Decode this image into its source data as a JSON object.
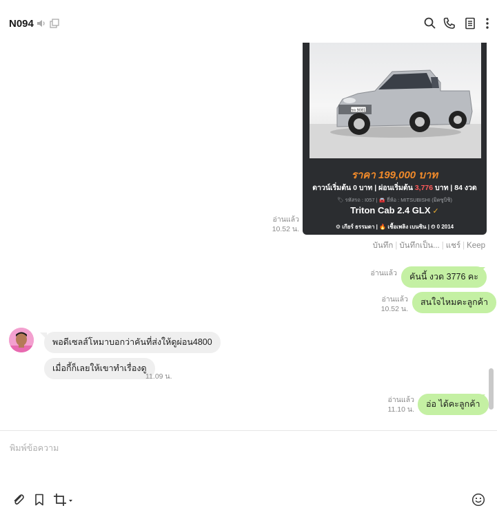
{
  "header": {
    "title": "N094",
    "icons": [
      "speaker-icon",
      "open-window-icon",
      "search-icon",
      "phone-icon",
      "note-icon",
      "more-icon"
    ]
  },
  "photo_card": {
    "price": "ราคา 199,000 บาท",
    "terms_prefix": "ดาวน์เริ่มต้น 0 บาท | ผ่อนเริ่มต้น ",
    "terms_installment": "3,776",
    "terms_suffix": " บาท | 84 งวด",
    "code_info": "🏷 รหัสรถ : I057 | 🚘 ยี่ห้อ : MITSUBISHI (มิตซูบิชิ)",
    "model": "Triton Cab 2.4 GLX",
    "specs": "⚙ เกียร์ ธรรมดา   |   🔥 เชื้อเพลิง เบนซิน   |   ⏲ 0 2014",
    "plate": "ขจ 9081"
  },
  "photo_meta": {
    "read": "อ่านแล้ว",
    "time": "10.52 น."
  },
  "photo_actions": [
    "บันทึก",
    "บันทึกเป็น...",
    "แชร์",
    "Keep"
  ],
  "messages": [
    {
      "side": "mine",
      "text": "คันนี้ งวด 3776 คะ",
      "read": "อ่านแล้ว",
      "time": ""
    },
    {
      "side": "mine",
      "text": "สนใจไหมคะลูกค้า",
      "read": "อ่านแล้ว",
      "time": "10.52 น."
    },
    {
      "side": "theirs",
      "text": "พอดีเซลส์โหมาบอกว่าคันที่ส่งให้ดูผ่อน4800",
      "time": ""
    },
    {
      "side": "theirs",
      "text": "เมื่อกี้ก็เลยให้เขาทำเรื่องดู",
      "time": "11.09 น."
    },
    {
      "side": "mine",
      "text": "อ่อ ได้คะลูกค้า",
      "read": "อ่านแล้ว",
      "time": "11.10 น."
    }
  ],
  "input": {
    "placeholder": "พิมพ์ข้อความ",
    "value": ""
  },
  "colors": {
    "my_bubble": "#c4f0a3",
    "their_bubble": "#efefef",
    "price": "#f08a2a",
    "installment": "#ff5a5a"
  }
}
